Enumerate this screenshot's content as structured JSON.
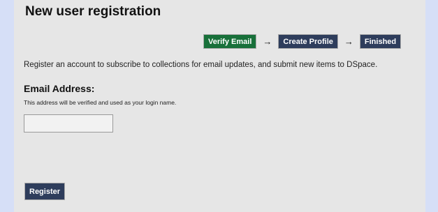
{
  "page": {
    "title": "New user registration",
    "intro": "Register an account to subscribe to collections for email updates, and submit new items to DSpace."
  },
  "steps": [
    {
      "label": "Verify Email",
      "state": "active"
    },
    {
      "label": "Create Profile",
      "state": "pending"
    },
    {
      "label": "Finished",
      "state": "pending"
    }
  ],
  "arrow": "→",
  "form": {
    "email_label": "Email Address:",
    "email_help": "This address will be verified and used as your login name.",
    "email_value": ""
  },
  "actions": {
    "register_label": "Register"
  },
  "colors": {
    "active_step": "#18703a",
    "pending_step": "#2e3d5c",
    "panel_bg": "#e6e6e6",
    "page_bg": "#d6dff7"
  }
}
